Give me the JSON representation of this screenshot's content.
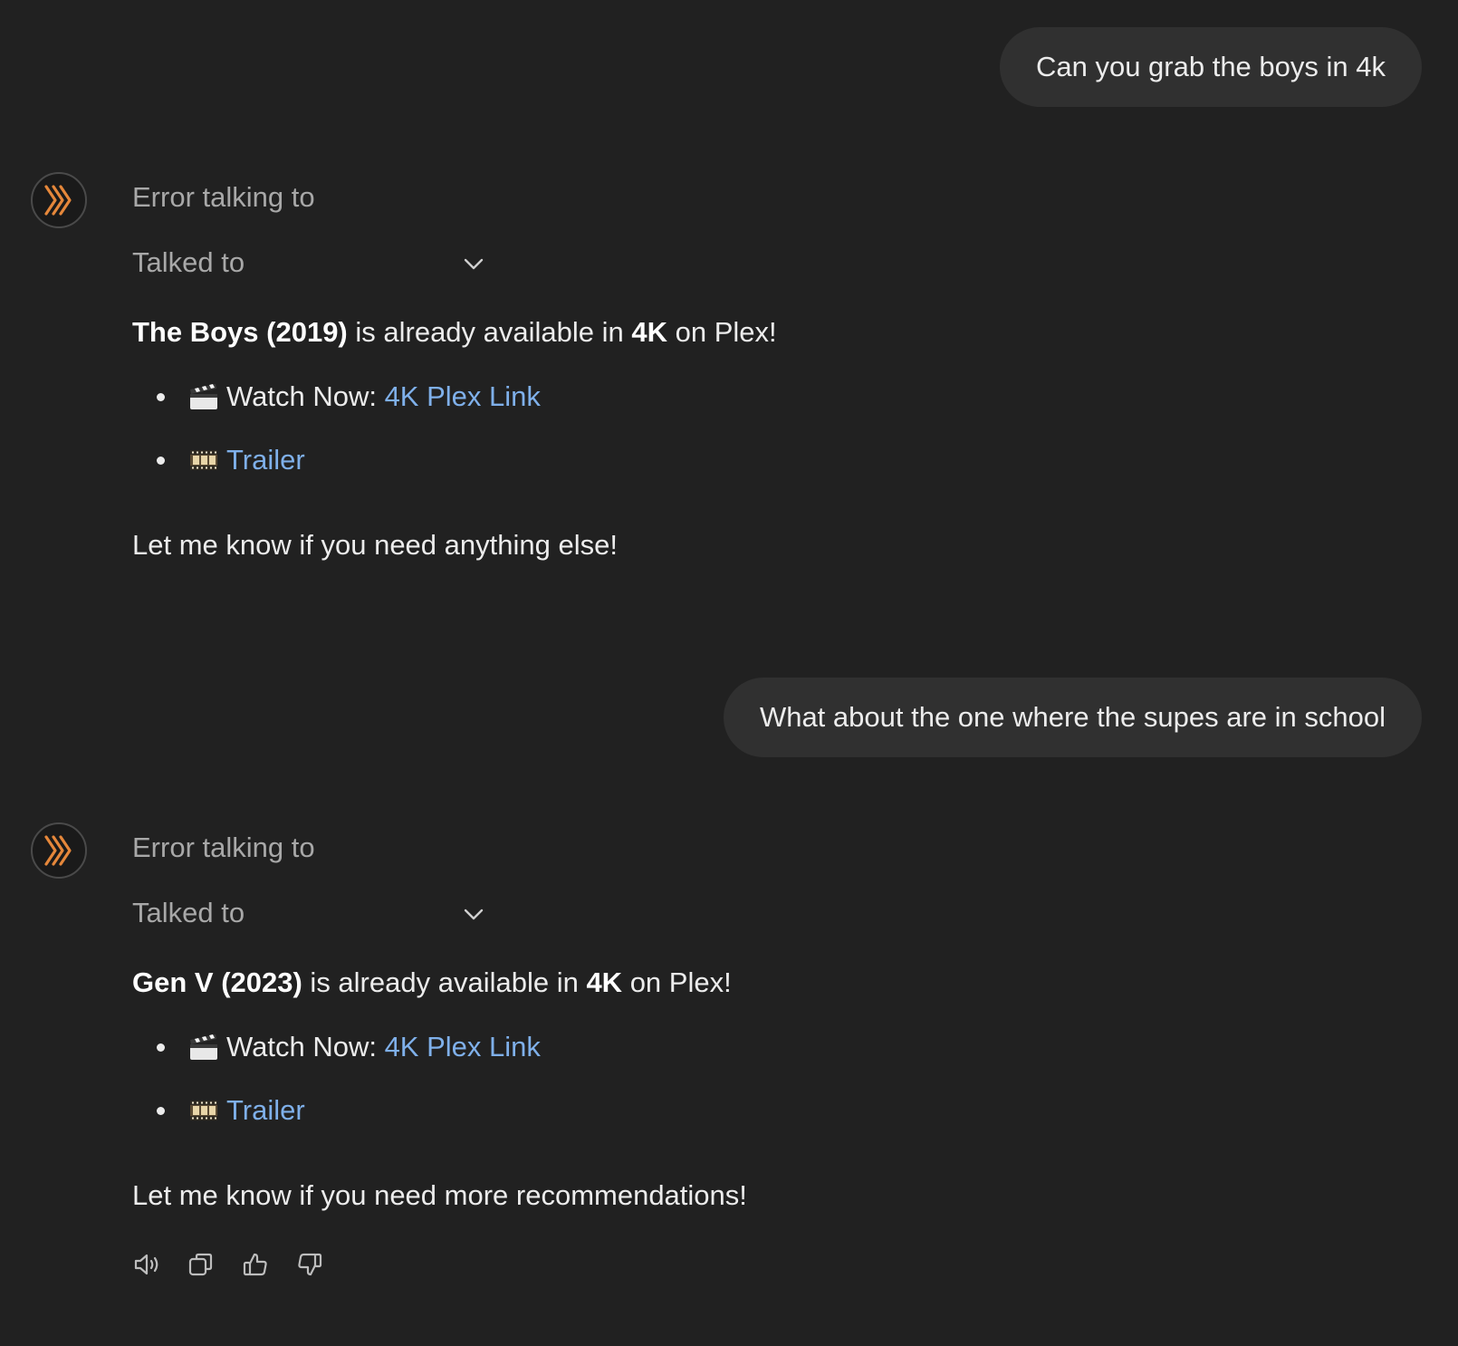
{
  "conversation": {
    "user_messages": [
      {
        "text": "Can you grab the boys in 4k"
      },
      {
        "text": "What about the one where the supes are in school"
      }
    ],
    "assistant_messages": [
      {
        "status": "Error talking to",
        "talked_to_label": "Talked to",
        "title": "The Boys (2019)",
        "middle": " is already available in ",
        "quality": "4K",
        "tail": " on Plex!",
        "items": [
          {
            "emoji": "clapper-board-icon",
            "prefix": "Watch Now: ",
            "link": "4K Plex Link"
          },
          {
            "emoji": "film-frames-icon",
            "prefix": "",
            "link": "Trailer"
          }
        ],
        "closing": "Let me know if you need anything else!"
      },
      {
        "status": "Error talking to",
        "talked_to_label": "Talked to",
        "title": "Gen V (2023)",
        "middle": " is already available in ",
        "quality": "4K",
        "tail": " on Plex!",
        "items": [
          {
            "emoji": "clapper-board-icon",
            "prefix": "Watch Now: ",
            "link": "4K Plex Link"
          },
          {
            "emoji": "film-frames-icon",
            "prefix": "",
            "link": "Trailer"
          }
        ],
        "closing": "Let me know if you need more recommendations!"
      }
    ]
  },
  "actions": [
    "read-aloud-icon",
    "copy-icon",
    "thumbs-up-icon",
    "thumbs-down-icon"
  ],
  "colors": {
    "background": "#212121",
    "user_bubble": "#303030",
    "link": "#7fb0ea",
    "muted_text": "#a8a8a8",
    "plex_orange": "#e5873a"
  }
}
